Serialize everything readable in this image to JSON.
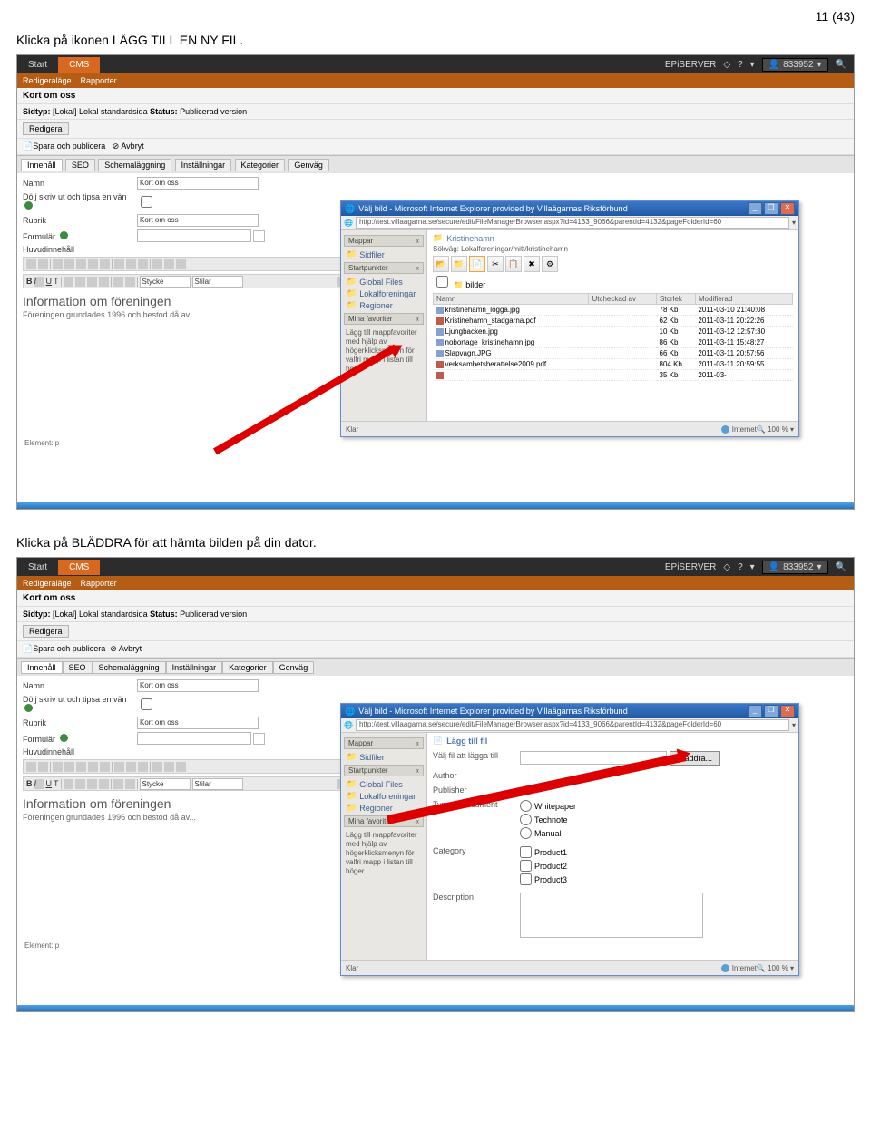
{
  "page_number": "11 (43)",
  "instruction1": "Klicka på ikonen LÄGG TILL EN NY FIL.",
  "instruction2": "Klicka på BLÄDDRA för att hämta bilden på din dator.",
  "topbar": {
    "start": "Start",
    "cms": "CMS",
    "brand": "EPiSERVER",
    "user": "833952",
    "user_prefix": "▾"
  },
  "subbar": {
    "a": "Redigeraläge",
    "b": "Rapporter"
  },
  "card": {
    "title": "Kort om oss",
    "meta_pref": "Sidtyp:",
    "meta_type": "[Lokal] Lokal standardsida",
    "status_l": "Status:",
    "status": "Publicerad version",
    "edit": "Redigera",
    "save": "Spara och publicera",
    "cancel": "Avbryt"
  },
  "tabs": [
    "Innehåll",
    "SEO",
    "Schemaläggning",
    "Inställningar",
    "Kategorier",
    "Genväg"
  ],
  "fields": {
    "name_l": "Namn",
    "name_v": "Kort om oss",
    "hide_l": "Dölj skriv ut och tipsa en vän",
    "rubr_l": "Rubrik",
    "rubr_v": "Kort om oss",
    "form_l": "Formulär",
    "huv_l": "Huvudinnehåll",
    "style_l": "Stycke",
    "styles_l": "Stilar",
    "rte_h": "Information om föreningen",
    "rte_s": "Föreningen grundades 1996 och bestod då av...",
    "element": "Element: p"
  },
  "popup": {
    "title": "Välj bild - Microsoft Internet Explorer provided by Villaägarnas Riksförbund",
    "url": "http://test.villaagarna.se/secure/edit/FileManagerBrowser.aspx?id=4133_9066&parentId=4132&pageFolderId=60",
    "side": {
      "mappar": "Mappar",
      "sidfiler": "Sidfiler",
      "start": "Startpunkter",
      "global": "Global Files",
      "lokal": "Lokalforeningar",
      "reg": "Regioner",
      "fav": "Mina favoriter",
      "note": "Lägg till mappfavoriter med hjälp av högerklicksmenyn för valfri mapp i listan till höger"
    },
    "main": {
      "crumb": "Kristinehamn",
      "path_l": "Sökväg:",
      "path": "Lokalforeningar/mitt/kristinehamn",
      "bilder": "bilder",
      "cols": {
        "name": "Namn",
        "chk": "Utcheckad av",
        "size": "Storlek",
        "mod": "Modifierad"
      },
      "files": [
        {
          "ico": "img",
          "n": "kristinehamn_logga.jpg",
          "s": "78 Kb",
          "m": "2011-03-10 21:40:08"
        },
        {
          "ico": "pdf",
          "n": "Kristinehamn_stadgarna.pdf",
          "s": "62 Kb",
          "m": "2011-03-11 20:22:26"
        },
        {
          "ico": "img",
          "n": "Ljungbacken.jpg",
          "s": "10 Kb",
          "m": "2011-03-12 12:57:30"
        },
        {
          "ico": "img",
          "n": "nobortage_kristinehamn.jpg",
          "s": "86 Kb",
          "m": "2011-03-11 15:48:27"
        },
        {
          "ico": "img",
          "n": "Slapvagn.JPG",
          "s": "66 Kb",
          "m": "2011-03-11 20:57:56"
        },
        {
          "ico": "pdf",
          "n": "verksamhetsberattelse2009.pdf",
          "s": "804 Kb",
          "m": "2011-03-11 20:59:55"
        },
        {
          "ico": "pdf",
          "n": "",
          "s": "35 Kb",
          "m": "2011-03-"
        }
      ]
    },
    "add": {
      "title": "Lägg till fil",
      "file_l": "Välj fil att lägga till",
      "browse": "Bläddra...",
      "author": "Author",
      "publisher": "Publisher",
      "typedoc": "Type of document",
      "opts": [
        "Whitepaper",
        "Technote",
        "Manual"
      ],
      "cat": "Category",
      "cats": [
        "Product1",
        "Product2",
        "Product3"
      ],
      "desc": "Description"
    },
    "status": {
      "klar": "Klar",
      "net": "Internet",
      "zoom": "100 %"
    }
  }
}
